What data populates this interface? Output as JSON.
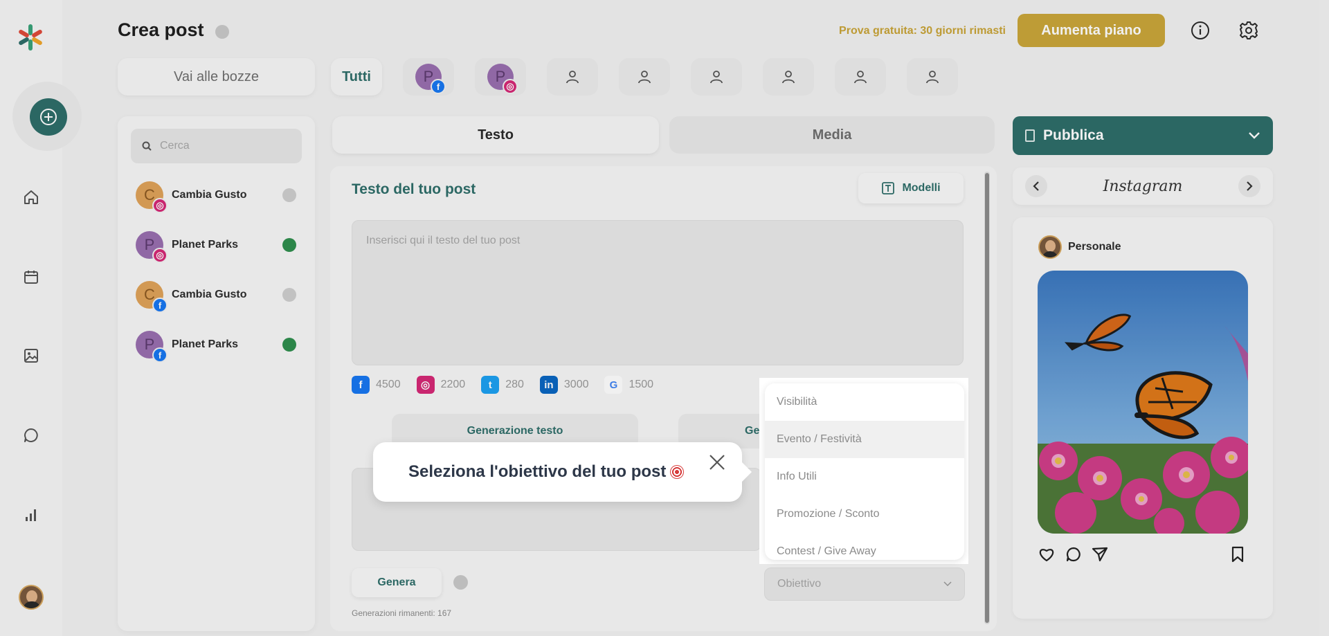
{
  "header": {
    "title": "Crea post",
    "trial_text": "Prova gratuita: 30 giorni rimasti",
    "upgrade_label": "Aumenta piano"
  },
  "accounts_bar": {
    "drafts_label": "Vai alle bozze",
    "all_label": "Tutti",
    "profiles": [
      {
        "initial": "P",
        "network": "facebook"
      },
      {
        "initial": "P",
        "network": "instagram"
      }
    ]
  },
  "left_panel": {
    "search_placeholder": "Cerca",
    "accounts": [
      {
        "initial": "C",
        "name": "Cambia Gusto",
        "network": "instagram",
        "active": false
      },
      {
        "initial": "P",
        "name": "Planet Parks",
        "network": "instagram",
        "active": true
      },
      {
        "initial": "C",
        "name": "Cambia Gusto",
        "network": "facebook",
        "active": false
      },
      {
        "initial": "P",
        "name": "Planet Parks",
        "network": "facebook",
        "active": true
      }
    ]
  },
  "tabs": {
    "text": "Testo",
    "media": "Media"
  },
  "editor": {
    "title": "Testo del tuo post",
    "models_label": "Modelli",
    "post_placeholder": "Inserisci qui il testo del tuo post",
    "limits": [
      {
        "network": "facebook",
        "value": "4500"
      },
      {
        "network": "instagram",
        "value": "2200"
      },
      {
        "network": "twitter",
        "value": "280"
      },
      {
        "network": "linkedin",
        "value": "3000"
      },
      {
        "network": "google",
        "value": "1500"
      }
    ],
    "gen_text_tab": "Generazione testo",
    "gen_other_tab": "Gen",
    "generate_label": "Genera",
    "remaining_text": "Generazioni rimanenti: 167",
    "goal_placeholder": "Obiettivo"
  },
  "preview": {
    "publish_label": "Pubblica",
    "network_name": "Instagram",
    "profile_name": "Personale"
  },
  "tour": {
    "tooltip_text": "Seleziona l'obiettivo del tuo post",
    "options": [
      "Visibilità",
      "Evento / Festività",
      "Info Utili",
      "Promozione / Sconto",
      "Contest / Give Away"
    ],
    "highlighted_index": 1
  },
  "colors": {
    "brand": "#2e6e6a",
    "accent": "#caa63a",
    "active_dot": "#2f8f4e",
    "inactive_dot": "#cfcfcf",
    "facebook": "#1877f2",
    "instagram": "#d62976",
    "twitter": "#1da1f2",
    "linkedin": "#0a66c2"
  }
}
